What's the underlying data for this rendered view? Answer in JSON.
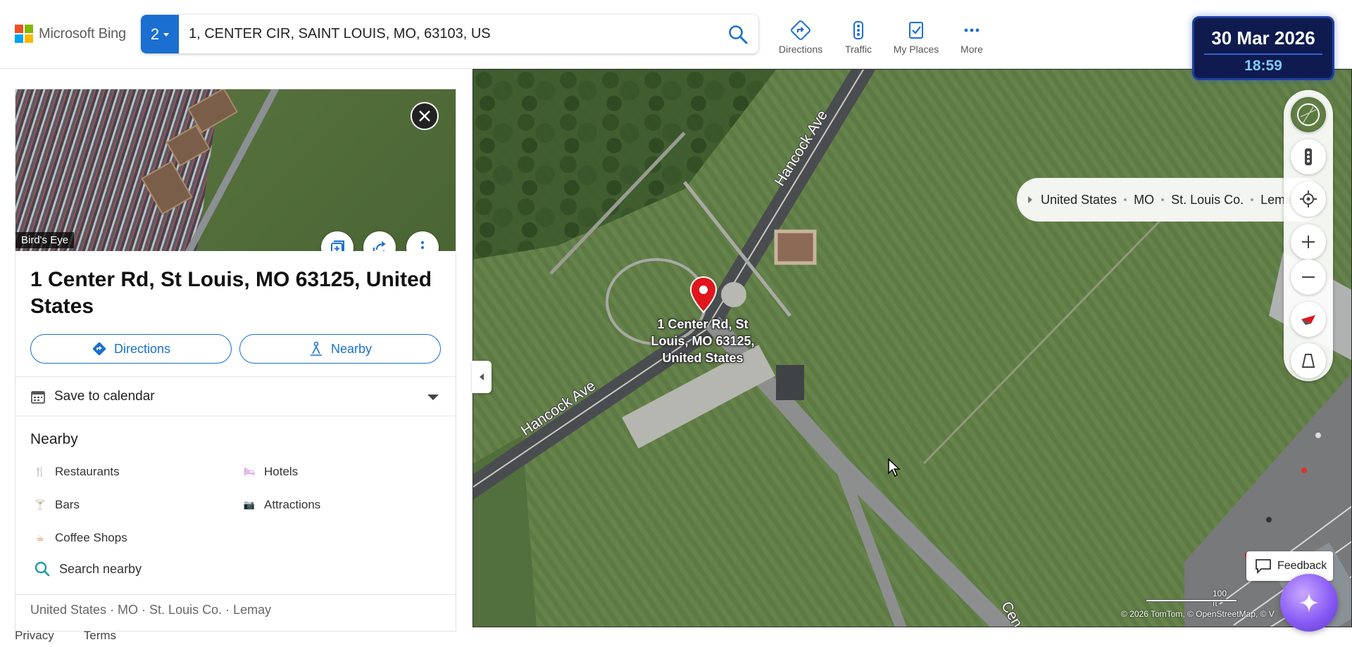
{
  "header": {
    "brand": "Microsoft Bing",
    "logo_colors": [
      "#f25022",
      "#7fba00",
      "#00a4ef",
      "#ffb900"
    ],
    "search": {
      "result_count": "2",
      "query": "1, CENTER CIR, SAINT LOUIS, MO, 63103, US",
      "icon": "search-icon"
    },
    "nav": [
      {
        "label": "Directions",
        "icon": "directions-icon"
      },
      {
        "label": "Traffic",
        "icon": "traffic-icon"
      },
      {
        "label": "My Places",
        "icon": "my-places-icon"
      },
      {
        "label": "More",
        "icon": "more-icon"
      }
    ],
    "datetime": {
      "date": "30 Mar 2026",
      "time": "18:59"
    }
  },
  "panel": {
    "hero_label": "Bird's Eye",
    "title": "1 Center Rd, St Louis, MO 63125, United States",
    "actions": {
      "directions": "Directions",
      "nearby": "Nearby"
    },
    "save_to_calendar": "Save to calendar",
    "nearby_heading": "Nearby",
    "nearby_items": [
      {
        "label": "Restaurants",
        "icon": "restaurant-icon",
        "color": "#e8743b"
      },
      {
        "label": "Hotels",
        "icon": "hotel-icon",
        "color": "#c24ad8"
      },
      {
        "label": "Bars",
        "icon": "bar-icon",
        "color": "#e8743b"
      },
      {
        "label": "Attractions",
        "icon": "attractions-icon",
        "color": "#1a9aa0"
      },
      {
        "label": "Coffee Shops",
        "icon": "coffee-icon",
        "color": "#e8743b"
      }
    ],
    "search_nearby": "Search nearby",
    "breadcrumb": "United States · MO · St. Louis Co. · Lemay"
  },
  "footer": {
    "privacy": "Privacy",
    "terms": "Terms"
  },
  "map": {
    "breadcrumb": [
      "United States",
      "MO",
      "St. Louis Co.",
      "Lemay"
    ],
    "pin_label": "1 Center Rd, St Louis, MO 63125, United States",
    "road_labels": [
      "Hancock Ave",
      "Hancock Ave",
      "Cen"
    ],
    "feedback": "Feedback",
    "scale": "100 ft",
    "attribution": "© 2026 TomTom, © OpenStreetMap, © V",
    "accent": "#1a6fd1",
    "pin_color": "#e0161c"
  }
}
